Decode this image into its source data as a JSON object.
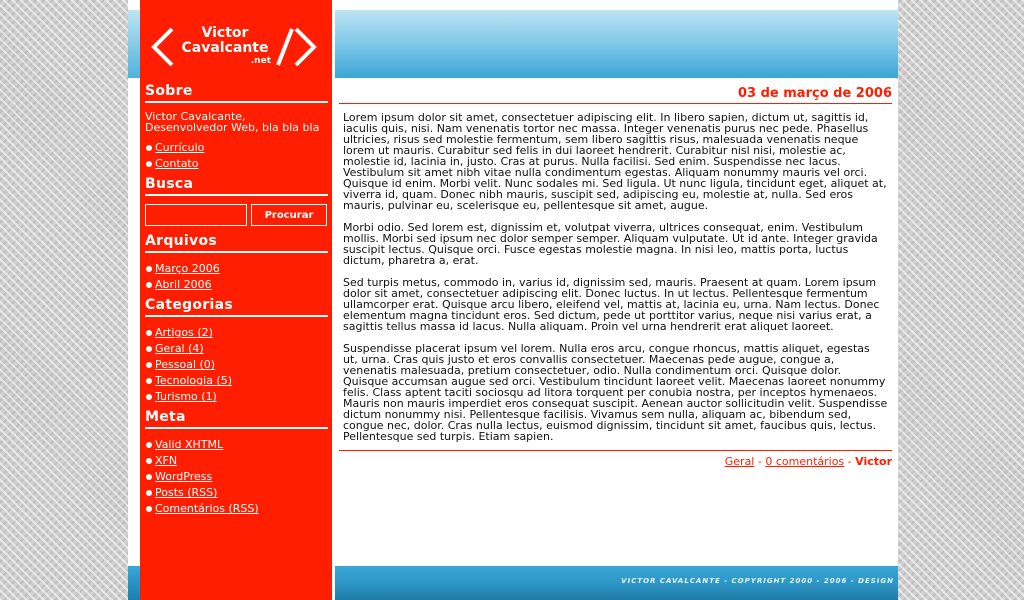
{
  "logo": {
    "line1": "Victor",
    "line2": "Cavalcante",
    "line3": ".net"
  },
  "sidebar": {
    "sobre": {
      "heading": "Sobre",
      "text": "Victor Cavalcante, Desenvolvedor Web, bla bla bla",
      "links": [
        "Currículo",
        "Contato"
      ]
    },
    "busca": {
      "heading": "Busca",
      "input_value": "",
      "button_label": "Procurar"
    },
    "arquivos": {
      "heading": "Arquivos",
      "links": [
        "Março 2006",
        "Abril 2006"
      ]
    },
    "categorias": {
      "heading": "Categorias",
      "links": [
        "Artigos (2)",
        "Geral (4)",
        "Pessoal (0)",
        "Tecnologia (5)",
        "Turismo (1)"
      ]
    },
    "meta": {
      "heading": "Meta",
      "links": [
        "Valid XHTML",
        "XFN",
        "WordPress",
        "Posts (RSS)",
        "Comentários (RSS)"
      ]
    }
  },
  "post": {
    "date": "03 de março de 2006",
    "paragraphs": [
      "Lorem ipsum dolor sit amet, consectetuer adipiscing elit. In libero sapien, dictum ut, sagittis id, iaculis quis, nisi. Nam venenatis tortor nec massa. Integer venenatis purus nec pede. Phasellus ultricies, risus sed molestie fermentum, sem libero sagittis risus, malesuada venenatis neque lorem ut mauris. Curabitur sed felis in dui laoreet hendrerit. Curabitur nisl nisi, molestie ac, molestie id, lacinia in, justo. Cras at purus. Nulla facilisi. Sed enim. Suspendisse nec lacus. Vestibulum sit amet nibh vitae nulla condimentum egestas. Aliquam nonummy mauris vel orci. Quisque id enim. Morbi velit. Nunc sodales mi. Sed ligula. Ut nunc ligula, tincidunt eget, aliquet at, viverra id, quam. Donec nibh mauris, suscipit sed, adipiscing eu, molestie at, nulla. Sed eros mauris, pulvinar eu, scelerisque eu, pellentesque sit amet, augue.",
      "Morbi odio. Sed lorem est, dignissim et, volutpat viverra, ultrices consequat, enim. Vestibulum mollis. Morbi sed ipsum nec dolor semper semper. Aliquam vulputate. Ut id ante. Integer gravida suscipit lectus. Quisque orci. Fusce egestas molestie magna. In nisi leo, mattis porta, luctus dictum, pharetra a, erat.",
      "Sed turpis metus, commodo in, varius id, dignissim sed, mauris. Praesent at quam. Lorem ipsum dolor sit amet, consectetuer adipiscing elit. Donec luctus. In ut lectus. Pellentesque fermentum ullamcorper erat. Quisque arcu libero, eleifend vel, mattis at, lacinia eu, urna. Nam lectus. Donec elementum magna tincidunt eros. Sed dictum, pede ut porttitor varius, neque nisi varius erat, a sagittis tellus massa id lacus. Nulla aliquam. Proin vel urna hendrerit erat aliquet laoreet.",
      "Suspendisse placerat ipsum vel lorem. Nulla eros arcu, congue rhoncus, mattis aliquet, egestas ut, urna. Cras quis justo et eros convallis consectetuer. Maecenas pede augue, congue a, venenatis malesuada, pretium consectetuer, odio. Nulla condimentum orci. Quisque dolor. Quisque accumsan augue sed orci. Vestibulum tincidunt laoreet velit. Maecenas laoreet nonummy felis. Class aptent taciti sociosqu ad litora torquent per conubia nostra, per inceptos hymenaeos. Mauris non mauris imperdiet eros consequat suscipit. Aenean auctor sollicitudin velit. Suspendisse dictum nonummy nisi. Pellentesque facilisis. Vivamus sem nulla, aliquam ac, bibendum sed, congue nec, dolor. Cras nulla lectus, euismod dignissim, tincidunt sit amet, faucibus quis, lectus. Pellentesque sed turpis. Etiam sapien."
    ],
    "footer": {
      "category": "Geral",
      "separator1": " - ",
      "comments": "0 comentários",
      "separator2": " - ",
      "author": "Victor"
    }
  },
  "footer": {
    "text": "VICTOR CAVALCANTE - COPYRIGHT 2000 - 2006 - DESIGN"
  },
  "colors": {
    "accent": "#ff1e00",
    "banner_light": "#bfe4f3",
    "banner_dark": "#3aa6d6"
  }
}
